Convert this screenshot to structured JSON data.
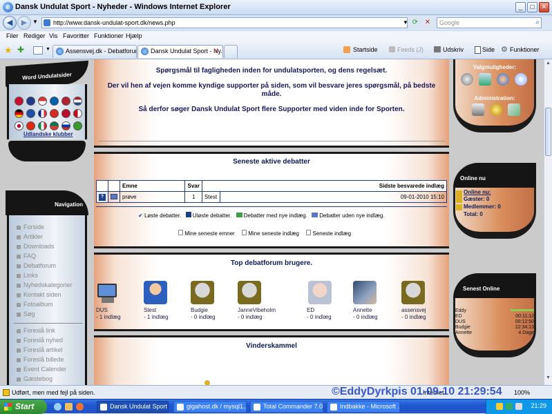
{
  "window": {
    "title": "Dansk Undulat Sport - Nyheder - Windows Internet Explorer"
  },
  "address": {
    "url": "http://www.dansk-undulat-sport.dk/news.php",
    "search_placeholder": "Google"
  },
  "menu": [
    "Filer",
    "Rediger",
    "Vis",
    "Favoritter",
    "Funktioner",
    "Hjælp"
  ],
  "tabs": [
    {
      "label": "Assensvej.dk - Debatforum: ..."
    },
    {
      "label": "Dansk Undulat Sport - Ny..."
    }
  ],
  "commands": {
    "startside": "Startside",
    "feeds": "Feeds (J)",
    "udskriv": "Udskriv",
    "side": "Side",
    "funktioner": "Funktioner"
  },
  "left": {
    "word_title": "Word Undulatsider",
    "word_link": "Udlandske klubber",
    "nav_title": "Navigation",
    "nav_items": [
      "Forside",
      "Artikler",
      "Downloads",
      "FAQ",
      "Debatforum",
      "Links",
      "Nyhedskategorier",
      "Kontakt siden",
      "Fotoalbum",
      "Søg"
    ],
    "suggest_items": [
      "Foreslå link",
      "Foreslå nyhed",
      "Foreslå artikel",
      "Foreslå billede",
      "Event Calender",
      "Gæstebog"
    ]
  },
  "main": {
    "intro": [
      "Spørgsmål til fagligheden inden for undulatsporten, og dens regelsæt.",
      "Der vil hen af vejen komme kyndige supporter på siden, som vil besvare jeres spørgsmål, på bedste måde.",
      "Så derfor søger Dansk Undulat Sport flere Supporter med viden inde for Sporten."
    ],
    "debates_title": "Seneste aktive debatter",
    "table": {
      "headers": [
        "Emne",
        "Svar",
        "Sidste besvarede indlæg"
      ],
      "rows": [
        {
          "icon": "?",
          "subject": "prøve",
          "replies": "1",
          "user": "Stest",
          "date": "09-01-2010 15:10"
        }
      ]
    },
    "legend": [
      "Løste debatter.",
      "Uløste debatter.",
      "Debatter med nye indlæg.",
      "Debatter uden nye indlæg."
    ],
    "my_links": [
      "Mine seneste emner",
      "Mine seneste indlæg",
      "Seneste indlæg"
    ],
    "top_title": "Top debatforum brugere.",
    "top_users": [
      {
        "name": "DUS",
        "posts": "- 1 indlæg",
        "avatar": "computer-avatar"
      },
      {
        "name": "Stest",
        "posts": "- 1 indlæg",
        "avatar": "boy-avatar"
      },
      {
        "name": "Budgie",
        "posts": "- 0 indlæg",
        "avatar": "budgie-avatar"
      },
      {
        "name": "JanneVibeholm",
        "posts": "- 0 indlæg",
        "avatar": "bruger-avatar"
      },
      {
        "name": "ED",
        "posts": "- 0 indlæg",
        "avatar": "photo-avatar"
      },
      {
        "name": "Annette",
        "posts": "- 0 indlæg",
        "avatar": "photo-avatar"
      },
      {
        "name": "assensvej",
        "posts": "- 0 indlæg",
        "avatar": "budgie-avatar"
      }
    ],
    "trophy_title": "Vinderskammel"
  },
  "right": {
    "options_title": "Valgmuligheder:",
    "admin_title": "Administration:",
    "online_title": "Online nu",
    "online_label": "Online nu:",
    "guests": "Gæster: 0",
    "members": "Medlemmer: 0",
    "total": "Total: 0",
    "last_online_title": "Senest Online",
    "last_online": [
      {
        "name": "Eddy",
        "time": ""
      },
      {
        "name": "ED",
        "time": "00:11:12"
      },
      {
        "name": "DUS",
        "time": "00:12:50"
      },
      {
        "name": "Budgie",
        "time": "22:34:13"
      },
      {
        "name": "Annette",
        "time": "4 Dage"
      }
    ]
  },
  "status": {
    "text": "Udført, men med fejl på siden.",
    "zone": "Internet",
    "zoom": "100%"
  },
  "watermark": "©EddyDyrkpis 01-09-10 21:29:54",
  "taskbar": {
    "start": "Start",
    "tasks": [
      "Dansk Undulat Sport ...",
      "gigahost.dk / mysql1...",
      "Total Commander 7.0...",
      "Indbakke - Microsoft ..."
    ],
    "clock": "21:29"
  }
}
